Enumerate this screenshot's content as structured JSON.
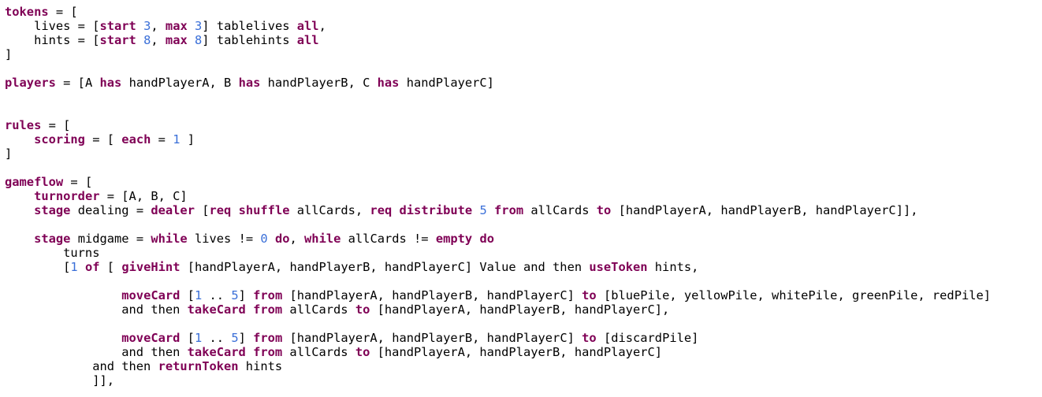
{
  "colors": {
    "keyword": "#7f0055",
    "number": "#3a6fd8",
    "text": "#000000",
    "background": "#ffffff"
  },
  "lines": [
    {
      "row": 0,
      "tokens": [
        [
          "kw",
          "tokens"
        ],
        [
          "p",
          " = ["
        ]
      ]
    },
    {
      "row": 1,
      "tokens": [
        [
          "p",
          "    lives = ["
        ],
        [
          "kw",
          "start"
        ],
        [
          "p",
          " "
        ],
        [
          "num",
          "3"
        ],
        [
          "p",
          ", "
        ],
        [
          "kw",
          "max"
        ],
        [
          "p",
          " "
        ],
        [
          "num",
          "3"
        ],
        [
          "p",
          "] tablelives "
        ],
        [
          "kw",
          "all"
        ],
        [
          "p",
          ","
        ]
      ]
    },
    {
      "row": 2,
      "tokens": [
        [
          "p",
          "    hints = ["
        ],
        [
          "kw",
          "start"
        ],
        [
          "p",
          " "
        ],
        [
          "num",
          "8"
        ],
        [
          "p",
          ", "
        ],
        [
          "kw",
          "max"
        ],
        [
          "p",
          " "
        ],
        [
          "num",
          "8"
        ],
        [
          "p",
          "] tablehints "
        ],
        [
          "kw",
          "all"
        ]
      ]
    },
    {
      "row": 3,
      "tokens": [
        [
          "p",
          "]"
        ]
      ]
    },
    {
      "row": 5,
      "tokens": [
        [
          "kw",
          "players"
        ],
        [
          "p",
          " = [A "
        ],
        [
          "kw",
          "has"
        ],
        [
          "p",
          " handPlayerA, B "
        ],
        [
          "kw",
          "has"
        ],
        [
          "p",
          " handPlayerB, C "
        ],
        [
          "kw",
          "has"
        ],
        [
          "p",
          " handPlayerC]"
        ]
      ]
    },
    {
      "row": 8,
      "tokens": [
        [
          "kw",
          "rules"
        ],
        [
          "p",
          " = ["
        ]
      ]
    },
    {
      "row": 9,
      "tokens": [
        [
          "p",
          "    "
        ],
        [
          "kw",
          "scoring"
        ],
        [
          "p",
          " = [ "
        ],
        [
          "kw",
          "each"
        ],
        [
          "p",
          " = "
        ],
        [
          "num",
          "1"
        ],
        [
          "p",
          " ]"
        ]
      ]
    },
    {
      "row": 10,
      "tokens": [
        [
          "p",
          "]"
        ]
      ]
    },
    {
      "row": 12,
      "tokens": [
        [
          "kw",
          "gameflow"
        ],
        [
          "p",
          " = ["
        ]
      ]
    },
    {
      "row": 13,
      "tokens": [
        [
          "p",
          "    "
        ],
        [
          "kw",
          "turnorder"
        ],
        [
          "p",
          " = [A, B, C]"
        ]
      ]
    },
    {
      "row": 14,
      "tokens": [
        [
          "p",
          "    "
        ],
        [
          "kw",
          "stage"
        ],
        [
          "p",
          " dealing = "
        ],
        [
          "kw",
          "dealer"
        ],
        [
          "p",
          " ["
        ],
        [
          "kw",
          "req"
        ],
        [
          "p",
          " "
        ],
        [
          "kw",
          "shuffle"
        ],
        [
          "p",
          " allCards, "
        ],
        [
          "kw",
          "req"
        ],
        [
          "p",
          " "
        ],
        [
          "kw",
          "distribute"
        ],
        [
          "p",
          " "
        ],
        [
          "num",
          "5"
        ],
        [
          "p",
          " "
        ],
        [
          "kw",
          "from"
        ],
        [
          "p",
          " allCards "
        ],
        [
          "kw",
          "to"
        ],
        [
          "p",
          " [handPlayerA, handPlayerB, handPlayerC]],"
        ]
      ]
    },
    {
      "row": 16,
      "tokens": [
        [
          "p",
          "    "
        ],
        [
          "kw",
          "stage"
        ],
        [
          "p",
          " midgame = "
        ],
        [
          "kw",
          "while"
        ],
        [
          "p",
          " lives != "
        ],
        [
          "num",
          "0"
        ],
        [
          "p",
          " "
        ],
        [
          "kw",
          "do"
        ],
        [
          "p",
          ", "
        ],
        [
          "kw",
          "while"
        ],
        [
          "p",
          " allCards != "
        ],
        [
          "kw",
          "empty"
        ],
        [
          "p",
          " "
        ],
        [
          "kw",
          "do"
        ]
      ]
    },
    {
      "row": 17,
      "tokens": [
        [
          "p",
          "        turns"
        ]
      ]
    },
    {
      "row": 18,
      "tokens": [
        [
          "p",
          "        ["
        ],
        [
          "num",
          "1"
        ],
        [
          "p",
          " "
        ],
        [
          "kw",
          "of"
        ],
        [
          "p",
          " [ "
        ],
        [
          "kw",
          "giveHint"
        ],
        [
          "p",
          " [handPlayerA, handPlayerB, handPlayerC] Value and then "
        ],
        [
          "kw",
          "useToken"
        ],
        [
          "p",
          " hints,"
        ]
      ]
    },
    {
      "row": 20,
      "tokens": [
        [
          "p",
          "                "
        ],
        [
          "kw",
          "moveCard"
        ],
        [
          "p",
          " ["
        ],
        [
          "num",
          "1"
        ],
        [
          "p",
          " .. "
        ],
        [
          "num",
          "5"
        ],
        [
          "p",
          "] "
        ],
        [
          "kw",
          "from"
        ],
        [
          "p",
          " [handPlayerA, handPlayerB, handPlayerC] "
        ],
        [
          "kw",
          "to"
        ],
        [
          "p",
          " [bluePile, yellowPile, whitePile, greenPile, redPile]"
        ]
      ]
    },
    {
      "row": 21,
      "tokens": [
        [
          "p",
          "                and then "
        ],
        [
          "kw",
          "takeCard"
        ],
        [
          "p",
          " "
        ],
        [
          "kw",
          "from"
        ],
        [
          "p",
          " allCards "
        ],
        [
          "kw",
          "to"
        ],
        [
          "p",
          " [handPlayerA, handPlayerB, handPlayerC],"
        ]
      ]
    },
    {
      "row": 23,
      "tokens": [
        [
          "p",
          "                "
        ],
        [
          "kw",
          "moveCard"
        ],
        [
          "p",
          " ["
        ],
        [
          "num",
          "1"
        ],
        [
          "p",
          " .. "
        ],
        [
          "num",
          "5"
        ],
        [
          "p",
          "] "
        ],
        [
          "kw",
          "from"
        ],
        [
          "p",
          " [handPlayerA, handPlayerB, handPlayerC] "
        ],
        [
          "kw",
          "to"
        ],
        [
          "p",
          " [discardPile]"
        ]
      ]
    },
    {
      "row": 24,
      "tokens": [
        [
          "p",
          "                and then "
        ],
        [
          "kw",
          "takeCard"
        ],
        [
          "p",
          " "
        ],
        [
          "kw",
          "from"
        ],
        [
          "p",
          " allCards "
        ],
        [
          "kw",
          "to"
        ],
        [
          "p",
          " [handPlayerA, handPlayerB, handPlayerC]"
        ]
      ]
    },
    {
      "row": 25,
      "tokens": [
        [
          "p",
          "            and then "
        ],
        [
          "kw",
          "returnToken"
        ],
        [
          "p",
          " hints"
        ]
      ]
    },
    {
      "row": 26,
      "tokens": [
        [
          "p",
          "            ]],"
        ]
      ]
    }
  ]
}
